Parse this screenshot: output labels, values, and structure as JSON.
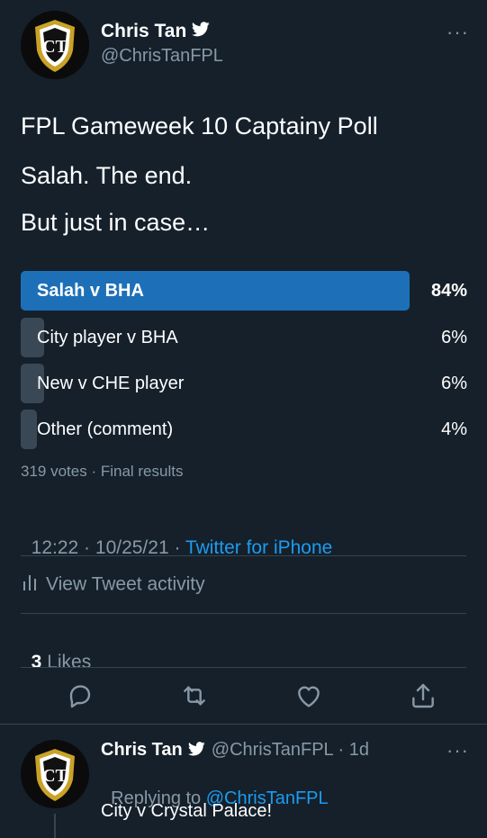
{
  "tweet": {
    "author_name": "Chris Tan",
    "author_handle": "@ChrisTanFPL",
    "text_lines": [
      "FPL Gameweek 10 Captainy Poll",
      "Salah. The end.",
      "But just in case…"
    ],
    "poll": {
      "options": [
        {
          "label": "Salah v BHA",
          "percent_text": "84%",
          "percent": 84
        },
        {
          "label": "City player v BHA",
          "percent_text": "6%",
          "percent": 6
        },
        {
          "label": "New v CHE player",
          "percent_text": "6%",
          "percent": 6
        },
        {
          "label": "Other (comment)",
          "percent_text": "4%",
          "percent": 4
        }
      ],
      "summary": "319 votes · Final results"
    },
    "time": "12:22 · 10/25/21 · ",
    "source": "Twitter for iPhone",
    "activity_label": "View Tweet activity",
    "likes_count": "3",
    "likes_label": " Likes"
  },
  "reply": {
    "author_name": "Chris Tan",
    "author_handle": "@ChrisTanFPL · 1d",
    "replying_prefix": "Replying to ",
    "replying_handle": "@ChrisTanFPL",
    "text": "City v Crystal Palace!"
  },
  "colors": {
    "background": "#15202b",
    "accent": "#1d9bf0",
    "poll_winner": "#1d70b8",
    "poll_other": "#3a4856",
    "muted_text": "#8899a6"
  }
}
